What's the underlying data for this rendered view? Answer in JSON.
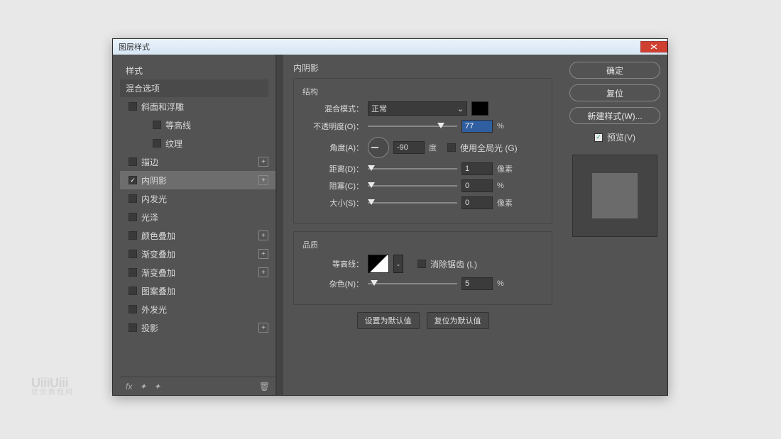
{
  "window": {
    "title": "图层样式"
  },
  "left": {
    "styles_label": "样式",
    "blend_label": "混合选项",
    "effects": [
      {
        "id": "bevel",
        "label": "斜面和浮雕",
        "checked": false,
        "plus": false,
        "indent": 0
      },
      {
        "id": "contour",
        "label": "等高线",
        "checked": false,
        "plus": false,
        "indent": 1
      },
      {
        "id": "texture",
        "label": "纹理",
        "checked": false,
        "plus": false,
        "indent": 1
      },
      {
        "id": "stroke",
        "label": "描边",
        "checked": false,
        "plus": true,
        "indent": 0
      },
      {
        "id": "innershadow",
        "label": "内阴影",
        "checked": true,
        "plus": true,
        "indent": 0,
        "selected": true
      },
      {
        "id": "innerglow",
        "label": "内发光",
        "checked": false,
        "plus": false,
        "indent": 0
      },
      {
        "id": "satin",
        "label": "光泽",
        "checked": false,
        "plus": false,
        "indent": 0
      },
      {
        "id": "coloroverlay",
        "label": "颜色叠加",
        "checked": false,
        "plus": true,
        "indent": 0
      },
      {
        "id": "gradientoverlay",
        "label": "渐变叠加",
        "checked": false,
        "plus": true,
        "indent": 0
      },
      {
        "id": "gradientoverlay2",
        "label": "渐变叠加",
        "checked": false,
        "plus": true,
        "indent": 0
      },
      {
        "id": "patternoverlay",
        "label": "图案叠加",
        "checked": false,
        "plus": false,
        "indent": 0
      },
      {
        "id": "outerglow",
        "label": "外发光",
        "checked": false,
        "plus": false,
        "indent": 0
      },
      {
        "id": "dropshadow",
        "label": "投影",
        "checked": false,
        "plus": true,
        "indent": 0
      }
    ],
    "footer_fx": "fx"
  },
  "center": {
    "heading": "内阴影",
    "structure": {
      "group_label": "结构",
      "blendmode_label": "混合模式：",
      "blendmode_value": "正常",
      "color": "#000000",
      "opacity_label": "不透明度(O)：",
      "opacity_value": "77",
      "opacity_unit": "%",
      "angle_label": "角度(A)：",
      "angle_value": "-90",
      "angle_unit": "度",
      "globallight_label": "使用全局光 (G)",
      "globallight_checked": false,
      "distance_label": "距离(D)：",
      "distance_value": "1",
      "distance_unit": "像素",
      "choke_label": "阻塞(C)：",
      "choke_value": "0",
      "choke_unit": "%",
      "size_label": "大小(S)：",
      "size_value": "0",
      "size_unit": "像素"
    },
    "quality": {
      "group_label": "品质",
      "contour_label": "等高线：",
      "antialias_label": "消除锯齿 (L)",
      "antialias_checked": false,
      "noise_label": "杂色(N)：",
      "noise_value": "5",
      "noise_unit": "%"
    },
    "buttons": {
      "make_default": "设置为默认值",
      "reset_default": "复位为默认值"
    }
  },
  "right": {
    "ok": "确定",
    "cancel": "复位",
    "newstyle": "新建样式(W)...",
    "preview_label": "预览(V)",
    "preview_checked": true
  },
  "watermark": {
    "main": "UiiiUiii",
    "sub": "优优教程网"
  }
}
